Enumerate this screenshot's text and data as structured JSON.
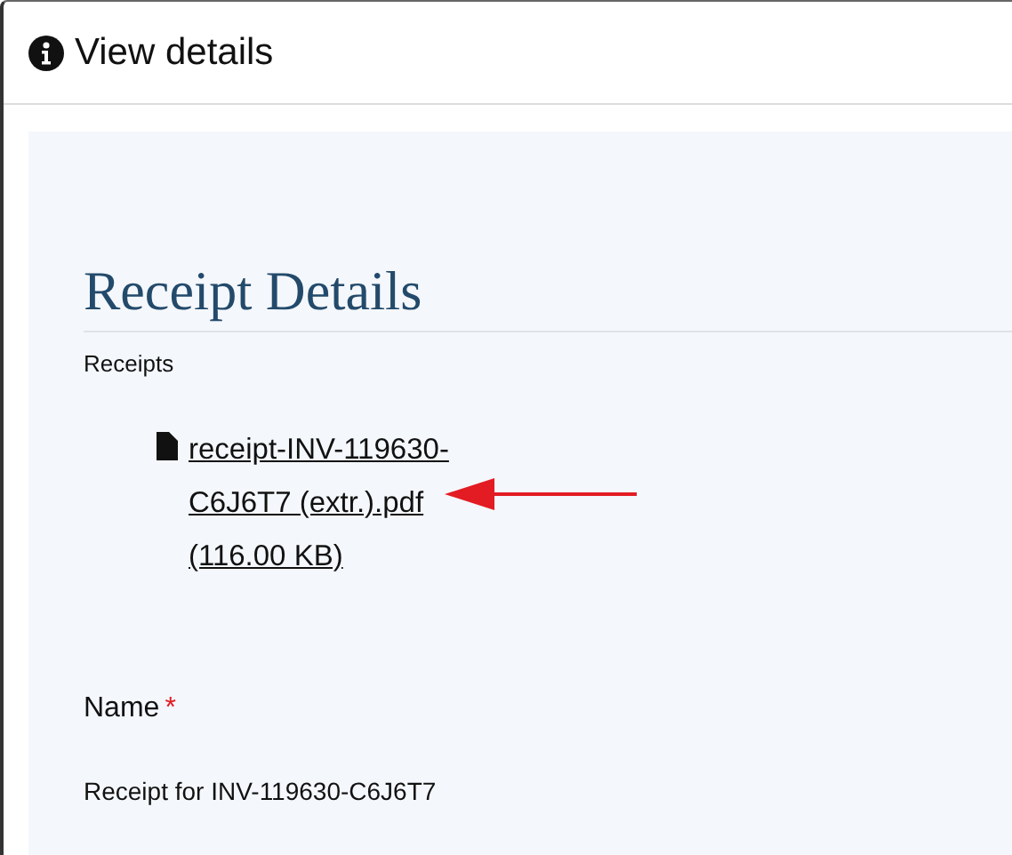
{
  "window": {
    "title": "View details"
  },
  "section": {
    "heading": "Receipt Details"
  },
  "receipts": {
    "label": "Receipts",
    "files": [
      {
        "link": "receipt-INV-119630-C6J6T7 (extr.).pdf (116.00 KB)",
        "highlighted": true
      }
    ]
  },
  "name_field": {
    "label": "Name",
    "required_mark": "*",
    "value": "Receipt for INV-119630-C6J6T7"
  }
}
